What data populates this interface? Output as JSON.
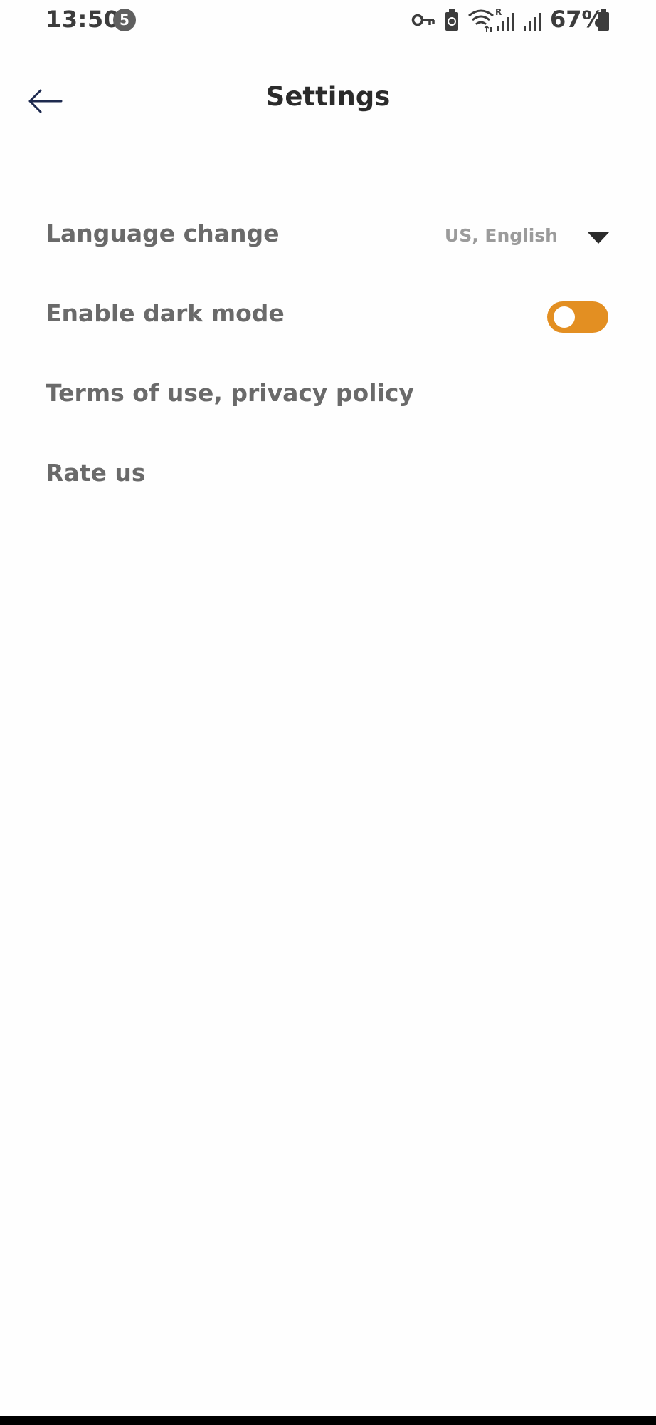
{
  "status_bar": {
    "time": "13:50",
    "notification_count": "5",
    "battery_percent": "67%",
    "icons": [
      "vpn-key-icon",
      "battery-saver-icon",
      "wifi-icon",
      "signal-roaming-icon",
      "signal-icon",
      "battery-icon"
    ]
  },
  "header": {
    "title": "Settings",
    "back_icon": "arrow-left-icon"
  },
  "settings": {
    "language": {
      "label": "Language change",
      "value": "US, English",
      "icon": "triangle-down-icon"
    },
    "dark_mode": {
      "label": "Enable dark mode",
      "enabled": false
    },
    "terms": {
      "label": "Terms of use, privacy policy"
    },
    "rate": {
      "label": "Rate us"
    }
  },
  "colors": {
    "accent": "#E38F22",
    "title_text": "#2B2B2B",
    "item_text": "#6A6A6A",
    "secondary_text": "#9B9B9B",
    "back_arrow": "#1E2A4F",
    "background": "#FEFEFE"
  }
}
